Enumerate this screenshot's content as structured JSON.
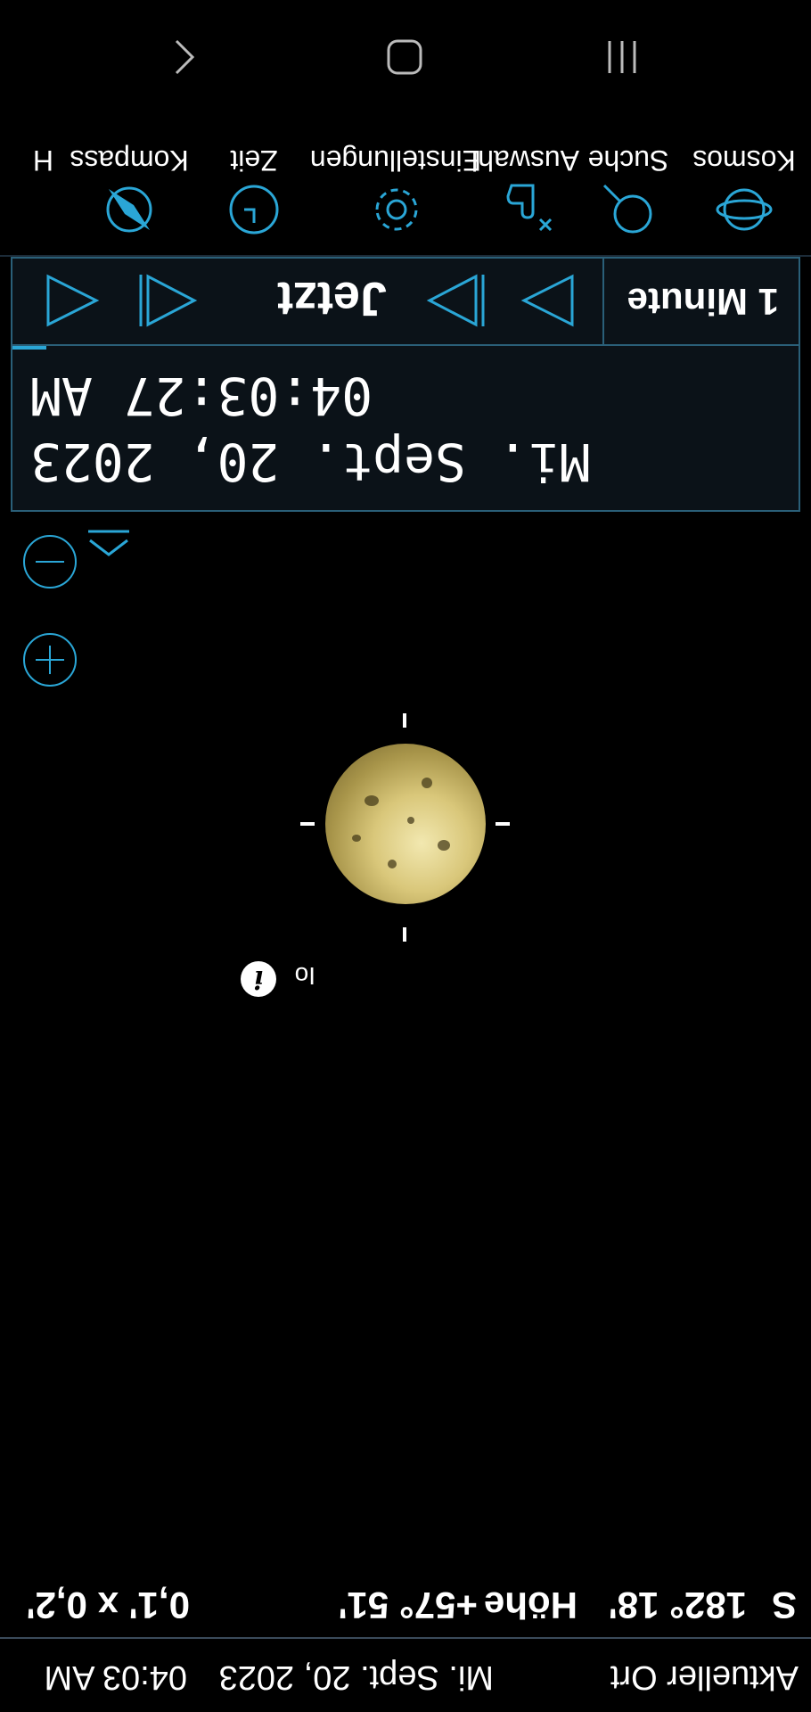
{
  "infobar": {
    "location": "Aktueller Ort",
    "date": "Mi. Sept. 20, 2023",
    "time": "04:03 AM",
    "direction": "S",
    "azimuth": "182° 18'",
    "altitude_label": "Höhe",
    "altitude": "+57° 51'",
    "fov": "0,1' x 0,2'"
  },
  "object": {
    "name": "Io"
  },
  "timepanel": {
    "date": "Mi. Sept. 20, 2023",
    "time": "04:03:27 AM",
    "step": "1 Minute",
    "now_label": "Jetzt"
  },
  "toolbar": {
    "items": [
      {
        "label": "Kosmos",
        "icon": "orbit-icon"
      },
      {
        "label": "Suche",
        "icon": "search-icon"
      },
      {
        "label": "Auswahl",
        "icon": "hand-pointer-icon"
      },
      {
        "label": "Einstellungen",
        "icon": "gear-icon"
      },
      {
        "label": "Zeit",
        "icon": "clock-icon"
      },
      {
        "label": "Kompass",
        "icon": "compass-icon"
      },
      {
        "label": "H",
        "icon": "help-icon"
      }
    ]
  },
  "colors": {
    "accent": "#2aa6d6",
    "panel_border": "#2a5f78",
    "panel_bg": "#0b1218"
  }
}
